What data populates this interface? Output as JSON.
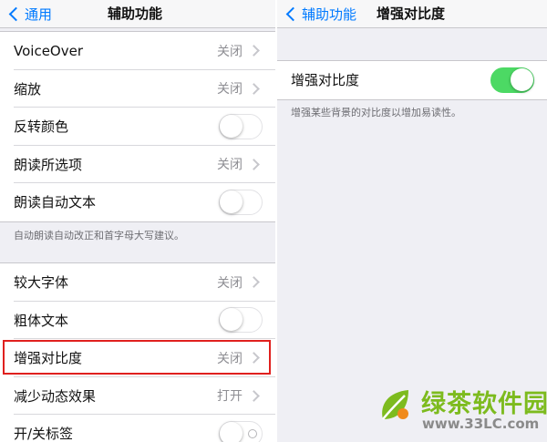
{
  "left": {
    "nav": {
      "back_label": "通用",
      "title": "辅助功能"
    },
    "group1": [
      {
        "label": "VoiceOver",
        "value": "关闭"
      },
      {
        "label": "缩放",
        "value": "关闭"
      },
      {
        "label": "反转颜色",
        "toggle": "off"
      },
      {
        "label": "朗读所选项",
        "value": "关闭"
      },
      {
        "label": "朗读自动文本",
        "toggle": "off"
      }
    ],
    "group1_footer": "自动朗读自动改正和首字母大写建议。",
    "group2": [
      {
        "label": "较大字体",
        "value": "关闭"
      },
      {
        "label": "粗体文本",
        "toggle": "off"
      },
      {
        "label": "增强对比度",
        "value": "关闭"
      },
      {
        "label": "减少动态效果",
        "value": "打开"
      },
      {
        "label": "开/关标签",
        "toggle": "off"
      }
    ]
  },
  "right": {
    "nav": {
      "back_label": "辅助功能",
      "title": "增强对比度"
    },
    "row": {
      "label": "增强对比度",
      "toggle": "on"
    },
    "footer": "增强某些背景的对比度以增加易读性。"
  },
  "watermark": {
    "name": "绿茶软件园",
    "url": "www.33LC.com"
  },
  "colors": {
    "accent": "#007aff",
    "toggle_on": "#4cd964",
    "highlight": "#e0201e",
    "watermark_green": "#7dbb1e"
  }
}
